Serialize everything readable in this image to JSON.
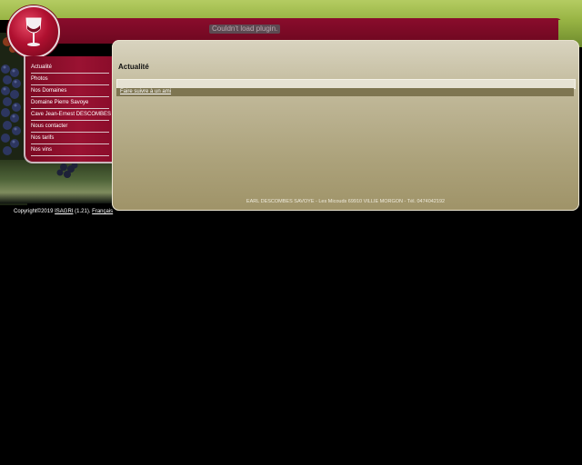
{
  "colors": {
    "top_band": "#b4cc62",
    "header": "#8a0c2c",
    "sidebar": "#9a1232",
    "panel": "#c1b99a",
    "background": "#000000"
  },
  "logo": {
    "icon": "wine-glass-icon"
  },
  "plugin_message": "Couldn't load plugin.",
  "sidebar": {
    "items": [
      {
        "label": "Actualité"
      },
      {
        "label": "Photos"
      },
      {
        "label": "Nos Domaines"
      },
      {
        "label": "Domaine Pierre Savoye"
      },
      {
        "label": "Cave Jean-Ernest DESCOMBES"
      },
      {
        "label": "Nous contacter"
      },
      {
        "label": "Nos tarifs"
      },
      {
        "label": "Nos vins"
      }
    ]
  },
  "main": {
    "title": "Actualité",
    "share_link": "Faire suivre à un ami",
    "footer_address": "EARL DESCOMBES SAVOYE - Les Micouds 69910 VILLIE MORGON - Tél. 0474042192"
  },
  "copyright": {
    "prefix": "Copyright©2019",
    "company": "ISAGRI",
    "version": "(1.21).",
    "language": "Français"
  }
}
